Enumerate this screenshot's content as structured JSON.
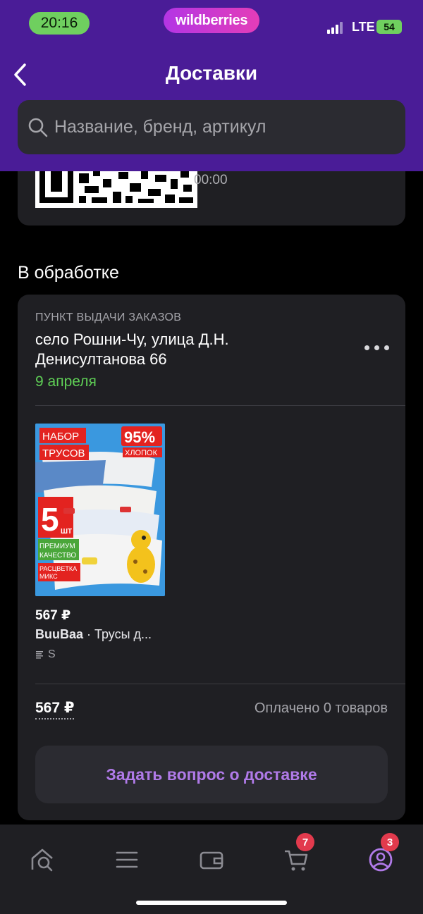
{
  "status_bar": {
    "time": "20:16",
    "brand": "wildberries",
    "network": "LTE",
    "battery": "54"
  },
  "header": {
    "title": "Доставки",
    "search_placeholder": "Название, бренд, артикул"
  },
  "qr_card": {
    "time": "00:00"
  },
  "section": {
    "title": "В обработке"
  },
  "order": {
    "pickup_label": "ПУНКТ ВЫДАЧИ ЗАКАЗОВ",
    "address": "село Рошни-Чу, улица Д.Н. Денисултанова 66",
    "date": "9 апреля",
    "product": {
      "price": "567 ₽",
      "brand": "BuuBaa",
      "name": " · Трусы д...",
      "size": "S",
      "image_text": {
        "line1": "НАБОР",
        "line2": "ТРУСОВ",
        "percent": "95%",
        "material": "ХЛОПОК",
        "count": "5",
        "count_unit": "ШТ",
        "premium1": "ПРЕМИУМ",
        "premium2": "КАЧЕСТВО",
        "color1": "РАСЦВЕТКА",
        "color2": "МИКС"
      }
    },
    "total": "567 ₽",
    "paid_text": "Оплачено 0 товаров",
    "ask_button": "Задать вопрос о доставке"
  },
  "bottom_nav": {
    "items": [
      {
        "icon": "home-search-icon"
      },
      {
        "icon": "menu-icon"
      },
      {
        "icon": "wallet-icon"
      },
      {
        "icon": "cart-icon",
        "badge": "7"
      },
      {
        "icon": "profile-icon",
        "badge": "3"
      }
    ]
  },
  "colors": {
    "header": "#4a1c97",
    "accent": "#b07ae8",
    "green": "#5fcf56",
    "badge": "#e23a4d"
  }
}
